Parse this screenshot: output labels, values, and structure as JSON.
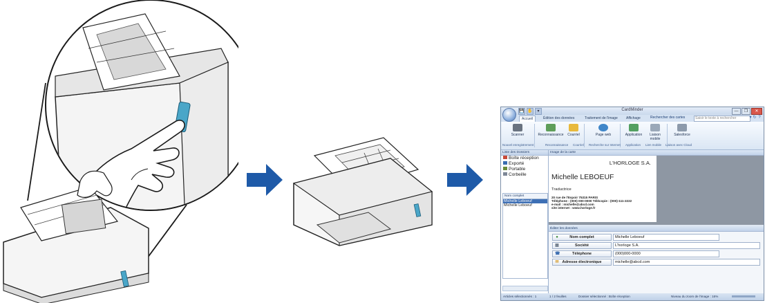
{
  "window": {
    "title": "CardMinder",
    "qat": [
      "💾",
      "✋",
      "▾"
    ],
    "controls": [
      "—",
      "❐",
      "✕"
    ]
  },
  "tabs": [
    "Accueil",
    "Édition des données",
    "Traitement de l'image",
    "Affichage"
  ],
  "search": {
    "label": "Rechercher des cartes",
    "placeholder": "Saisir le texte à rechercher"
  },
  "ribbon": {
    "buttons": [
      {
        "label": "Scanner",
        "icon": "scanner-icon"
      },
      {
        "label": "Reconnaissance",
        "icon": "recognition-icon"
      },
      {
        "label": "Courriel",
        "icon": "mail-icon"
      },
      {
        "label": "Page web",
        "icon": "globe-icon"
      },
      {
        "label": "Application",
        "icon": "application-icon"
      },
      {
        "label": "Liaison mobile",
        "icon": "mobile-link-icon"
      },
      {
        "label": "Salesforce",
        "icon": "salesforce-icon"
      }
    ],
    "groups": [
      "Nouvel enregistrement",
      "Reconnaissance",
      "Courriel",
      "Recherche sur Internet",
      "Application",
      "Lien mobile",
      "Liaison avec Cloud"
    ]
  },
  "folders_panel": {
    "header": "Liste des Dossiers",
    "folders": [
      {
        "label": "Boîte réception",
        "color": "#c84a38"
      },
      {
        "label": "Exporté",
        "color": "#3a6cb0"
      },
      {
        "label": "Portable",
        "color": "#6a8b3a"
      },
      {
        "label": "Corbeille",
        "color": "#7d8796"
      }
    ],
    "list_header": "Nom complet",
    "names": [
      "Michelle Leboeuf",
      "Michelle Leboeuf"
    ]
  },
  "image_panel": {
    "header": "Image de la carte",
    "card": {
      "company": "L'HORLOGE S.A.",
      "name": "Michelle LEBOEUF",
      "title": "Traductrice",
      "lines": [
        "20 rue de l'Espoir 75315 PARIS",
        "Téléphone : (000) 000-0000   Télécopie : (000)-111-2222",
        "e-mail : michelle@abcd.com",
        "site internet : www.horloge.fr"
      ]
    }
  },
  "edit_panel": {
    "header": "Éditer les données",
    "fields": [
      {
        "label": "Nom complet",
        "value": "Michelle Leboeuf",
        "icon": "person-icon"
      },
      {
        "label": "Société",
        "value": "L'horloge S.A.",
        "icon": "company-icon"
      },
      {
        "label": "Téléphone",
        "value": "(000)000-0000",
        "icon": "phone-icon"
      },
      {
        "label": "Adresse électronique",
        "value": "michelle@abcd.com",
        "icon": "email-icon"
      }
    ]
  },
  "status": {
    "selected": "Articles sélectionnés :   1",
    "pages": "1 /   2 feuilles",
    "folder": "Dossier sélectionné : Boîte réception",
    "zoom": "Niveau du zoom de l'image : 16%"
  },
  "colors": {
    "arrow": "#1e5aa8",
    "ribbon_accent": "#3d6fb5",
    "scanner_button": "#4aa6c8"
  }
}
